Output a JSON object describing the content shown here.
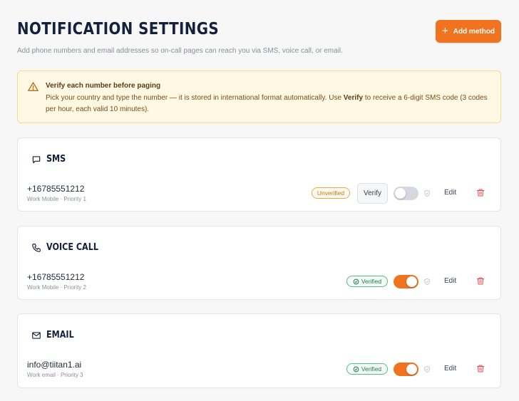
{
  "header": {
    "title": "NOTIFICATION SETTINGS",
    "subtitle": "Add phone numbers and email addresses so on-call pages can reach you via SMS, voice call, or email.",
    "add_button_label": "Add method",
    "add_button_icon": "plus-icon"
  },
  "alert": {
    "icon": "warning-triangle-icon",
    "title": "Verify each number before paging",
    "body_before": "Pick your country and type the number — it is stored in international format automatically. Use ",
    "body_bold": "Verify",
    "body_after": " to receive a 6-digit SMS code (3 codes per hour, each valid 10 minutes)."
  },
  "methods": [
    {
      "title": "SMS",
      "icon": "chat-bubble-icon",
      "value": "+16785551212",
      "meta": "Work Mobile · Priority 1",
      "status": "Unverified",
      "verify_label": "Verify",
      "enabled": false,
      "edit_label": "Edit"
    },
    {
      "title": "VOICE CALL",
      "icon": "phone-icon",
      "value": "+16785551212",
      "meta": "Work Mobile · Priority 2",
      "status": "Verified",
      "enabled": true,
      "edit_label": "Edit"
    },
    {
      "title": "EMAIL",
      "icon": "envelope-icon",
      "value": "info@tiitan1.ai",
      "meta": "Work email · Priority 3",
      "status": "Verified",
      "enabled": true,
      "edit_label": "Edit"
    }
  ],
  "colors": {
    "accent": "#f0731f",
    "title": "#14213d",
    "alert_bg": "#fff9e3",
    "verified": "#1f7a4f",
    "unverified": "#c87412",
    "danger": "#e5484d"
  }
}
